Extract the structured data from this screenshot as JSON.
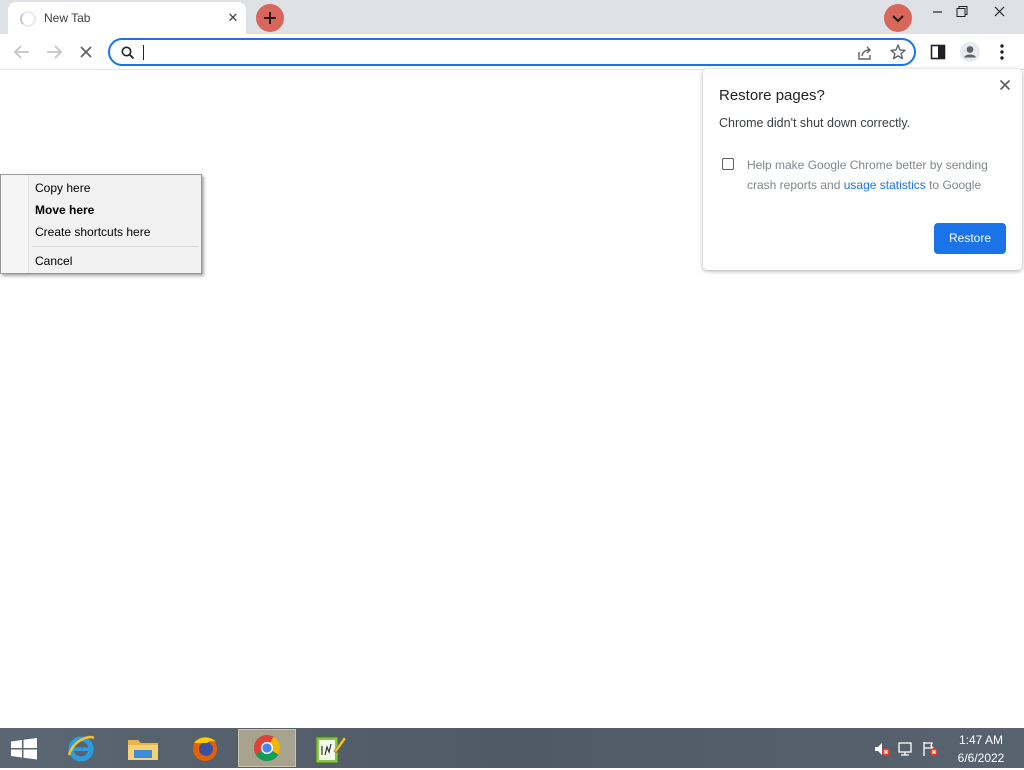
{
  "browser": {
    "tab": {
      "title": "New Tab",
      "close_glyph": "✕"
    },
    "window_controls": {
      "minimize": "minimize-icon",
      "restore": "restore-icon",
      "close": "close-icon"
    },
    "toolbar": {
      "back": "back-arrow-icon",
      "forward": "forward-arrow-icon",
      "stop": "stop-icon",
      "omnibox": {
        "value": "",
        "placeholder": ""
      }
    },
    "colors": {
      "accent": "#1a73e8",
      "tab_button": "#d9665a"
    }
  },
  "context_menu": {
    "items": [
      {
        "label": "Copy here"
      },
      {
        "label": "Move here"
      },
      {
        "label": "Create shortcuts here"
      },
      {
        "label": "Cancel"
      }
    ]
  },
  "restore_bubble": {
    "title": "Restore pages?",
    "message": "Chrome didn't shut down correctly.",
    "crash_text_before": "Help make Google Chrome better by sending crash reports and ",
    "crash_link": "usage statistics",
    "crash_text_after": " to Google",
    "checked": false,
    "button": "Restore"
  },
  "taskbar": {
    "apps": [
      "start-icon",
      "internet-explorer-icon",
      "file-explorer-icon",
      "firefox-icon",
      "chrome-icon",
      "notepad-icon"
    ],
    "clock": {
      "time": "1:47 AM",
      "date": "6/6/2022"
    }
  }
}
